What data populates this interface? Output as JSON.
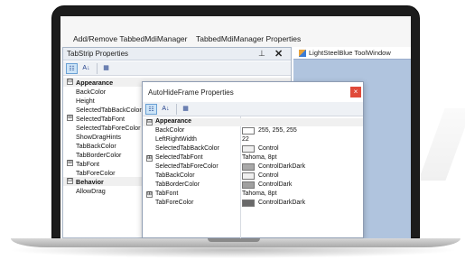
{
  "menubar": {
    "items": [
      "Add/Remove TabbedMdiManager",
      "TabbedMdiManager Properties"
    ]
  },
  "left_panel": {
    "title": "TabStrip Properties",
    "pin_icon": "pin-icon",
    "close_glyph": "✕",
    "rows": [
      {
        "name": "Appearance",
        "category": true,
        "expander": "⊟"
      },
      {
        "name": "BackColor"
      },
      {
        "name": "Height"
      },
      {
        "name": "SelectedTabBackColor"
      },
      {
        "name": "SelectedTabFont",
        "expander": "⊞"
      },
      {
        "name": "SelectedTabForeColor"
      },
      {
        "name": "ShowDragHints"
      },
      {
        "name": "TabBackColor"
      },
      {
        "name": "TabBorderColor"
      },
      {
        "name": "TabFont",
        "expander": "⊞"
      },
      {
        "name": "TabForeColor"
      },
      {
        "name": "Behavior",
        "category": true,
        "expander": "⊟"
      },
      {
        "name": "AllowDrag"
      }
    ]
  },
  "right_panel": {
    "tab_label": "LightSteelBlue ToolWindow",
    "background": "#b0c4de"
  },
  "dialog": {
    "title": "AutoHideFrame Properties",
    "close_glyph": "×",
    "rows": [
      {
        "name": "Appearance",
        "category": true,
        "expander": "⊟",
        "value": ""
      },
      {
        "name": "BackColor",
        "swatch": "#ffffff",
        "value": "255, 255, 255"
      },
      {
        "name": "LeftRightWidth",
        "value": "22"
      },
      {
        "name": "SelectedTabBackColor",
        "swatch": "#f0f0f0",
        "value": "Control"
      },
      {
        "name": "SelectedTabFont",
        "expander": "⊞",
        "value": "Tahoma, 8pt"
      },
      {
        "name": "SelectedTabForeColor",
        "swatch": "#a9a9a9",
        "value": "ControlDarkDark"
      },
      {
        "name": "TabBackColor",
        "swatch": "#f0f0f0",
        "value": "Control"
      },
      {
        "name": "TabBorderColor",
        "swatch": "#a0a0a0",
        "value": "ControlDark"
      },
      {
        "name": "TabFont",
        "expander": "⊞",
        "value": "Tahoma, 8pt"
      },
      {
        "name": "TabForeColor",
        "swatch": "#696969",
        "value": "ControlDarkDark"
      }
    ]
  },
  "toolbar": {
    "categorized_glyph": "☷",
    "alphabetical_glyph": "A↓",
    "pages_glyph": "▦"
  },
  "colors": {
    "laptop": "#1c1c1c",
    "accent_blue": "#6aa0d4",
    "close_red": "#e04a3a"
  }
}
